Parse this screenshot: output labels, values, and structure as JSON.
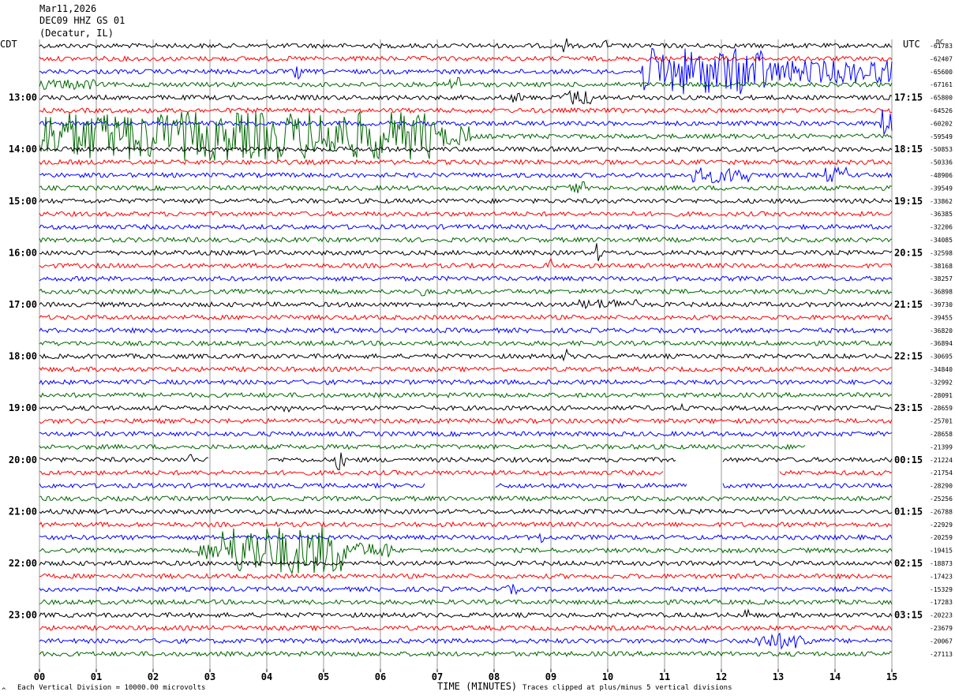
{
  "header": {
    "date": "Mar11,2026",
    "station": "DEC09 HHZ GS 01",
    "location": "(Decatur, IL)"
  },
  "left_zone": "CDT",
  "right_zone": "UTC",
  "dc_label": "DC",
  "footer": {
    "scale_note": "Each Vertical Division = 10000.00 microvolts",
    "clip_note": "Traces clipped at plus/minus 5 vertical divisions",
    "corner_mark": "^"
  },
  "colors": {
    "black": "#000000",
    "red": "#ff0000",
    "blue": "#0000ff",
    "green": "#006600",
    "grid": "#999999"
  },
  "chart_data": {
    "type": "helicorder",
    "xlabel": "TIME (MINUTES)",
    "x_ticks": [
      "00",
      "01",
      "02",
      "03",
      "04",
      "05",
      "06",
      "07",
      "08",
      "09",
      "10",
      "11",
      "12",
      "13",
      "14",
      "15"
    ],
    "xlim": [
      0,
      15
    ],
    "trace_color_cycle": [
      "black",
      "red",
      "blue",
      "green"
    ],
    "left_hour_labels": [
      {
        "row": 4,
        "label": "13:00"
      },
      {
        "row": 8,
        "label": "14:00"
      },
      {
        "row": 12,
        "label": "15:00"
      },
      {
        "row": 16,
        "label": "16:00"
      },
      {
        "row": 20,
        "label": "17:00"
      },
      {
        "row": 24,
        "label": "18:00"
      },
      {
        "row": 28,
        "label": "19:00"
      },
      {
        "row": 32,
        "label": "20:00"
      },
      {
        "row": 36,
        "label": "21:00"
      },
      {
        "row": 40,
        "label": "22:00"
      },
      {
        "row": 44,
        "label": "23:00"
      }
    ],
    "right_hour_labels": [
      {
        "row": 4,
        "label": "17:15"
      },
      {
        "row": 8,
        "label": "18:15"
      },
      {
        "row": 12,
        "label": "19:15"
      },
      {
        "row": 16,
        "label": "20:15"
      },
      {
        "row": 20,
        "label": "21:15"
      },
      {
        "row": 24,
        "label": "22:15"
      },
      {
        "row": 28,
        "label": "23:15"
      },
      {
        "row": 32,
        "label": "00:15"
      },
      {
        "row": 36,
        "label": "01:15"
      },
      {
        "row": 40,
        "label": "02:15"
      },
      {
        "row": 44,
        "label": "03:15"
      }
    ],
    "dc_offsets": [
      "-61783",
      "-62407",
      "-65600",
      "-67161",
      "-65800",
      "-64526",
      "-60202",
      "-59549",
      "-50853",
      "-50336",
      "-48906",
      "-39549",
      "-33862",
      "-36385",
      "-32206",
      "-34085",
      "-32598",
      "-38168",
      "-38257",
      "-36898",
      "-39730",
      "-39455",
      "-36820",
      "-36894",
      "-30695",
      "-34840",
      "-32992",
      "-28091",
      "-28659",
      "-25701",
      "-28658",
      "-21399",
      "-21224",
      "-21754",
      "-28290",
      "-25256",
      "-26788",
      "-22929",
      "-20259",
      "-19415",
      "-18873",
      "-17423",
      "-15329",
      "-17283",
      "-20223",
      "-23679",
      "-20067",
      "-27113"
    ],
    "events": [
      {
        "row": 0,
        "start_min": 9.2,
        "end_min": 9.3,
        "amplitude": 0.6
      },
      {
        "row": 0,
        "start_min": 9.9,
        "end_min": 10.0,
        "amplitude": 0.5
      },
      {
        "row": 2,
        "start_min": 10.6,
        "end_min": 12.8,
        "amplitude": 1.8
      },
      {
        "row": 2,
        "start_min": 12.8,
        "end_min": 15.0,
        "amplitude": 0.9
      },
      {
        "row": 2,
        "start_min": 4.5,
        "end_min": 4.6,
        "amplitude": 0.7
      },
      {
        "row": 3,
        "start_min": 7.2,
        "end_min": 7.4,
        "amplitude": 0.7
      },
      {
        "row": 3,
        "start_min": 0.0,
        "end_min": 1.0,
        "amplitude": 0.4
      },
      {
        "row": 4,
        "start_min": 9.2,
        "end_min": 9.8,
        "amplitude": 0.6
      },
      {
        "row": 4,
        "start_min": 8.3,
        "end_min": 8.5,
        "amplitude": 0.4
      },
      {
        "row": 6,
        "start_min": 14.8,
        "end_min": 15.0,
        "amplitude": 1.2
      },
      {
        "row": 7,
        "start_min": 0.0,
        "end_min": 7.0,
        "amplitude": 1.9
      },
      {
        "row": 7,
        "start_min": 7.0,
        "end_min": 7.6,
        "amplitude": 0.8
      },
      {
        "row": 10,
        "start_min": 11.5,
        "end_min": 12.5,
        "amplitude": 0.6
      },
      {
        "row": 10,
        "start_min": 13.8,
        "end_min": 14.2,
        "amplitude": 0.6
      },
      {
        "row": 11,
        "start_min": 9.3,
        "end_min": 9.6,
        "amplitude": 0.5
      },
      {
        "row": 16,
        "start_min": 9.8,
        "end_min": 9.9,
        "amplitude": 0.8
      },
      {
        "row": 17,
        "start_min": 8.9,
        "end_min": 9.0,
        "amplitude": 0.6
      },
      {
        "row": 19,
        "start_min": 6.7,
        "end_min": 6.8,
        "amplitude": 0.6
      },
      {
        "row": 20,
        "start_min": 9.5,
        "end_min": 10.5,
        "amplitude": 0.4
      },
      {
        "row": 24,
        "start_min": 9.2,
        "end_min": 9.3,
        "amplitude": 0.6
      },
      {
        "row": 28,
        "start_min": 4.3,
        "end_min": 4.4,
        "amplitude": 0.5
      },
      {
        "row": 28,
        "start_min": 11.3,
        "end_min": 11.4,
        "amplitude": 0.4
      },
      {
        "row": 32,
        "start_min": 2.6,
        "end_min": 2.7,
        "amplitude": 0.6
      },
      {
        "row": 32,
        "start_min": 5.2,
        "end_min": 5.4,
        "amplitude": 0.8
      },
      {
        "row": 38,
        "start_min": 8.8,
        "end_min": 8.9,
        "amplitude": 0.5
      },
      {
        "row": 39,
        "start_min": 3.2,
        "end_min": 5.4,
        "amplitude": 1.9
      },
      {
        "row": 39,
        "start_min": 2.8,
        "end_min": 3.2,
        "amplitude": 0.7
      },
      {
        "row": 39,
        "start_min": 5.4,
        "end_min": 6.2,
        "amplitude": 0.6
      },
      {
        "row": 42,
        "start_min": 8.2,
        "end_min": 8.4,
        "amplitude": 0.4
      },
      {
        "row": 44,
        "start_min": 12.4,
        "end_min": 12.5,
        "amplitude": 0.5
      },
      {
        "row": 46,
        "start_min": 12.6,
        "end_min": 13.6,
        "amplitude": 0.6
      }
    ],
    "gaps": [
      {
        "row": 31,
        "start_min": 13.5,
        "end_min": 15.0
      },
      {
        "row": 32,
        "start_min": 3.0,
        "end_min": 4.0
      },
      {
        "row": 32,
        "start_min": 11.2,
        "end_min": 12.0
      },
      {
        "row": 33,
        "start_min": 11.0,
        "end_min": 13.0
      },
      {
        "row": 34,
        "start_min": 6.8,
        "end_min": 8.0
      },
      {
        "row": 34,
        "start_min": 11.4,
        "end_min": 12.0
      }
    ]
  }
}
